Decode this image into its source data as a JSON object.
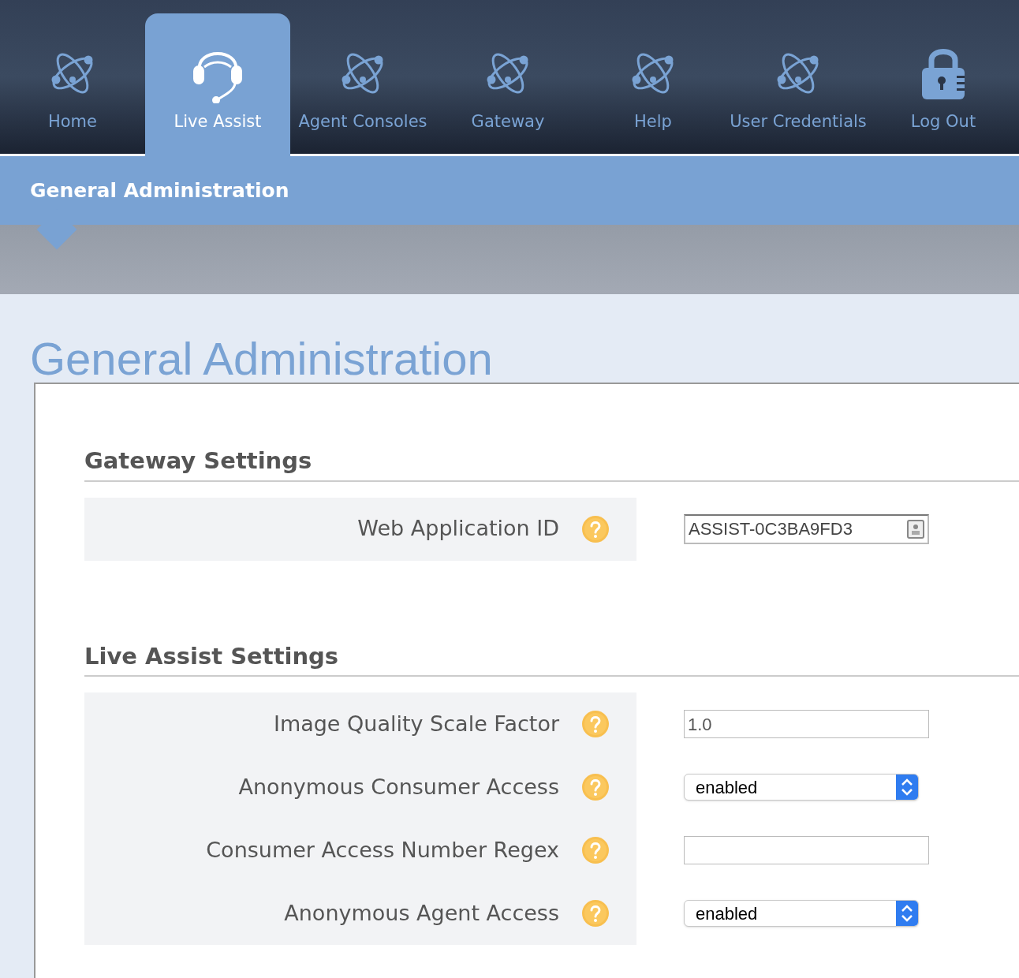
{
  "nav": {
    "items": [
      {
        "label": "Home",
        "kind": "section",
        "selected": false
      },
      {
        "label": "Live Assist",
        "kind": "assist",
        "selected": true
      },
      {
        "label": "Agent Consoles",
        "kind": "section",
        "selected": false
      },
      {
        "label": "Gateway",
        "kind": "section",
        "selected": false
      },
      {
        "label": "Help",
        "kind": "section",
        "selected": false
      },
      {
        "label": "User Credentials",
        "kind": "section",
        "selected": false
      },
      {
        "label": "Log Out",
        "kind": "logout",
        "selected": false
      }
    ]
  },
  "subnav": {
    "items": [
      {
        "label": "General Administration",
        "selected": true
      }
    ]
  },
  "page_title": "General Administration",
  "sections": [
    {
      "heading": "Gateway Settings",
      "rows": [
        {
          "label": "Web Application ID",
          "kind": "readonly",
          "value": "ASSIST-0C3BA9FD3"
        }
      ]
    },
    {
      "heading": "Live Assist Settings",
      "rows": [
        {
          "label": "Image Quality Scale Factor",
          "kind": "text",
          "value": "1.0"
        },
        {
          "label": "Anonymous Consumer Access",
          "kind": "select",
          "value": "enabled"
        },
        {
          "label": "Consumer Access Number Regex",
          "kind": "text"
        },
        {
          "label": "Anonymous Agent Access",
          "kind": "select",
          "value": "enabled"
        }
      ]
    }
  ]
}
